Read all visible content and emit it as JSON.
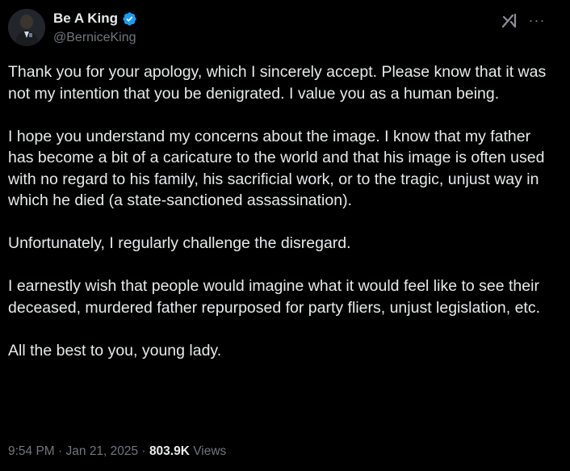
{
  "author": {
    "display_name": "Be A King",
    "handle": "@BerniceKing",
    "verified": true,
    "verified_color": "#1d9bf0"
  },
  "header_icons": {
    "grok": "grok-icon",
    "more": "more-icon",
    "more_glyph": "···"
  },
  "body": {
    "paragraphs": [
      "Thank you for your apology, which I sincerely accept. Please know that it was not my intention that you be denigrated. I value you as a human being.",
      "I hope you understand my concerns about the image. I know that my father has become a bit of a caricature to the world and that his image is often used with no regard to his family, his sacrificial work, or to the tragic, unjust way in which he died (a state-sanctioned assassination).",
      "Unfortunately, I regularly challenge the disregard.",
      "I earnestly wish that people would imagine what it would feel like to see their deceased, murdered father repurposed for party fliers, unjust legislation, etc.",
      "All the best to you, young lady."
    ]
  },
  "meta": {
    "time": "9:54 PM",
    "separator": " · ",
    "date": "Jan 21, 2025",
    "views_count": "803.9K",
    "views_label": " Views"
  },
  "colors": {
    "background": "#000000",
    "text_primary": "#e7e9ea",
    "text_secondary": "#71767b"
  }
}
